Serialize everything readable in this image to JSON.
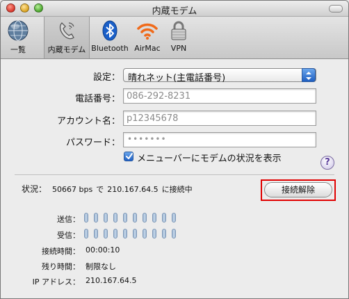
{
  "window": {
    "title": "内蔵モデム"
  },
  "toolbar": {
    "items": [
      {
        "label": "一覧",
        "icon": "globe-icon"
      },
      {
        "label": "内蔵モデム",
        "icon": "modem-phone-icon"
      },
      {
        "label": "Bluetooth",
        "icon": "bluetooth-icon"
      },
      {
        "label": "AirMac",
        "icon": "airmac-wifi-icon"
      },
      {
        "label": "VPN",
        "icon": "vpn-lock-icon"
      }
    ],
    "selected_index": 1
  },
  "form": {
    "config_label": "設定：",
    "config_value": "晴れネット(主電話番号)",
    "phone_label": "電話番号：",
    "phone_value": "086-292-8231",
    "account_label": "アカウント名：",
    "account_value": "p12345678",
    "password_label": "パスワード：",
    "password_value": "•••••••",
    "show_status_label": "メニューバーにモデムの状況を表示",
    "show_status_checked": true
  },
  "status": {
    "label": "状況：",
    "speed": "50667 bps",
    "connector": "で",
    "ip": "210.167.64.5",
    "suffix": "に接続中",
    "disconnect_button": "接続解除"
  },
  "meters": {
    "send_label": "送信：",
    "receive_label": "受信：",
    "bar_count": 10
  },
  "info": {
    "connect_time_label": "接続時間：",
    "connect_time_value": "00:00:10",
    "remaining_label": "残り時間：",
    "remaining_value": "制限なし",
    "ip_label": "IP アドレス：",
    "ip_value": "210.167.64.5"
  },
  "colors": {
    "accent": "#1f5fc2",
    "highlight_outline": "#e00000",
    "bar": "#b4c8de"
  }
}
